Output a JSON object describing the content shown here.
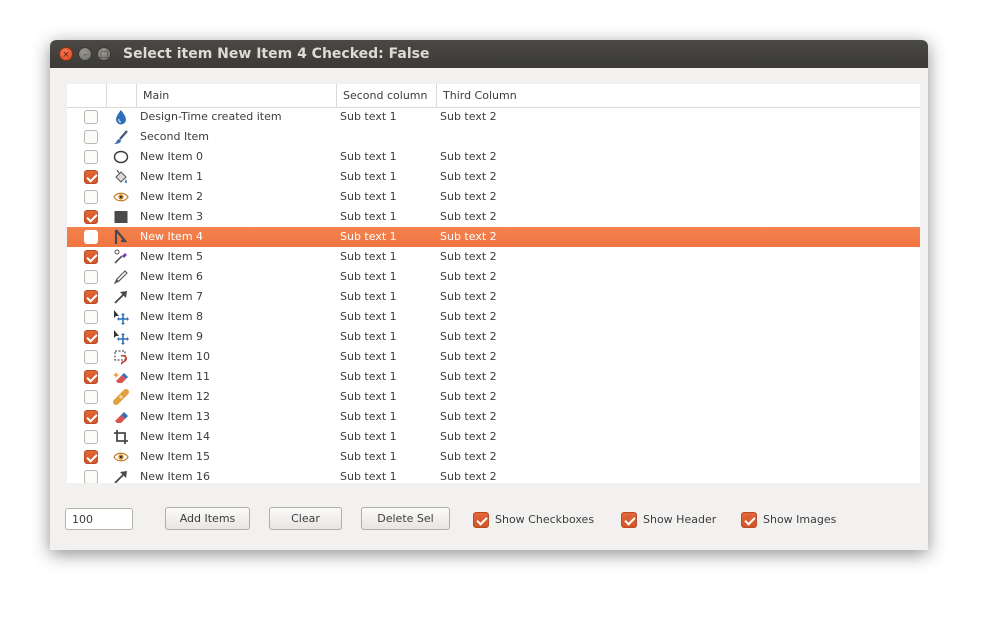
{
  "window": {
    "title": "Select item New Item 4 Checked: False",
    "close_glyph": "×",
    "minimize_glyph": "–",
    "maximize_glyph": "□"
  },
  "tree": {
    "columns": [
      "Main",
      "Second column",
      "Third Column"
    ],
    "selected_index": 6,
    "rows": [
      {
        "checked": false,
        "icon": "water-drop-icon",
        "main": "Design-Time created item",
        "second": "Sub text 1",
        "third": "Sub text 2"
      },
      {
        "checked": false,
        "icon": "paintbrush-icon",
        "main": "Second Item",
        "second": "",
        "third": ""
      },
      {
        "checked": false,
        "icon": "ellipse-icon",
        "main": "New Item 0",
        "second": "Sub text 1",
        "third": "Sub text 2"
      },
      {
        "checked": true,
        "icon": "fill-bucket-icon",
        "main": "New Item 1",
        "second": "Sub text 1",
        "third": "Sub text 2"
      },
      {
        "checked": false,
        "icon": "eye-icon",
        "main": "New Item 2",
        "second": "Sub text 1",
        "third": "Sub text 2"
      },
      {
        "checked": true,
        "icon": "rectangle-icon",
        "main": "New Item 3",
        "second": "Sub text 1",
        "third": "Sub text 2"
      },
      {
        "checked": false,
        "icon": "path-node-icon",
        "main": "New Item 4",
        "second": "Sub text 1",
        "third": "Sub text 2"
      },
      {
        "checked": true,
        "icon": "color-picker-icon",
        "main": "New Item 5",
        "second": "Sub text 1",
        "third": "Sub text 2"
      },
      {
        "checked": false,
        "icon": "pen-icon",
        "main": "New Item 6",
        "second": "Sub text 1",
        "third": "Sub text 2"
      },
      {
        "checked": true,
        "icon": "arrow-icon",
        "main": "New Item 7",
        "second": "Sub text 1",
        "third": "Sub text 2"
      },
      {
        "checked": false,
        "icon": "move-icon",
        "main": "New Item 8",
        "second": "Sub text 1",
        "third": "Sub text 2"
      },
      {
        "checked": true,
        "icon": "move-icon",
        "main": "New Item 9",
        "second": "Sub text 1",
        "third": "Sub text 2"
      },
      {
        "checked": false,
        "icon": "lasso-select-icon",
        "main": "New Item 10",
        "second": "Sub text 1",
        "third": "Sub text 2"
      },
      {
        "checked": true,
        "icon": "eraser-sparkle-icon",
        "main": "New Item 11",
        "second": "Sub text 1",
        "third": "Sub text 2"
      },
      {
        "checked": false,
        "icon": "bandage-icon",
        "main": "New Item 12",
        "second": "Sub text 1",
        "third": "Sub text 2"
      },
      {
        "checked": true,
        "icon": "eraser-icon",
        "main": "New Item 13",
        "second": "Sub text 1",
        "third": "Sub text 2"
      },
      {
        "checked": false,
        "icon": "crop-icon",
        "main": "New Item 14",
        "second": "Sub text 1",
        "third": "Sub text 2"
      },
      {
        "checked": true,
        "icon": "eye-icon",
        "main": "New Item 15",
        "second": "Sub text 1",
        "third": "Sub text 2"
      },
      {
        "checked": false,
        "icon": "arrow-icon",
        "main": "New Item 16",
        "second": "Sub text 1",
        "third": "Sub text 2"
      }
    ]
  },
  "controls": {
    "count_value": "100",
    "add_label": "Add Items",
    "clear_label": "Clear",
    "delete_label": "Delete Sel",
    "show_checkboxes": {
      "label": "Show Checkboxes",
      "checked": true
    },
    "show_header": {
      "label": "Show Header",
      "checked": true
    },
    "show_images": {
      "label": "Show Images",
      "checked": true
    }
  },
  "colors": {
    "selection": "#f07746",
    "check_accent": "#d95b2c",
    "titlebar": "#3f3e3a"
  }
}
